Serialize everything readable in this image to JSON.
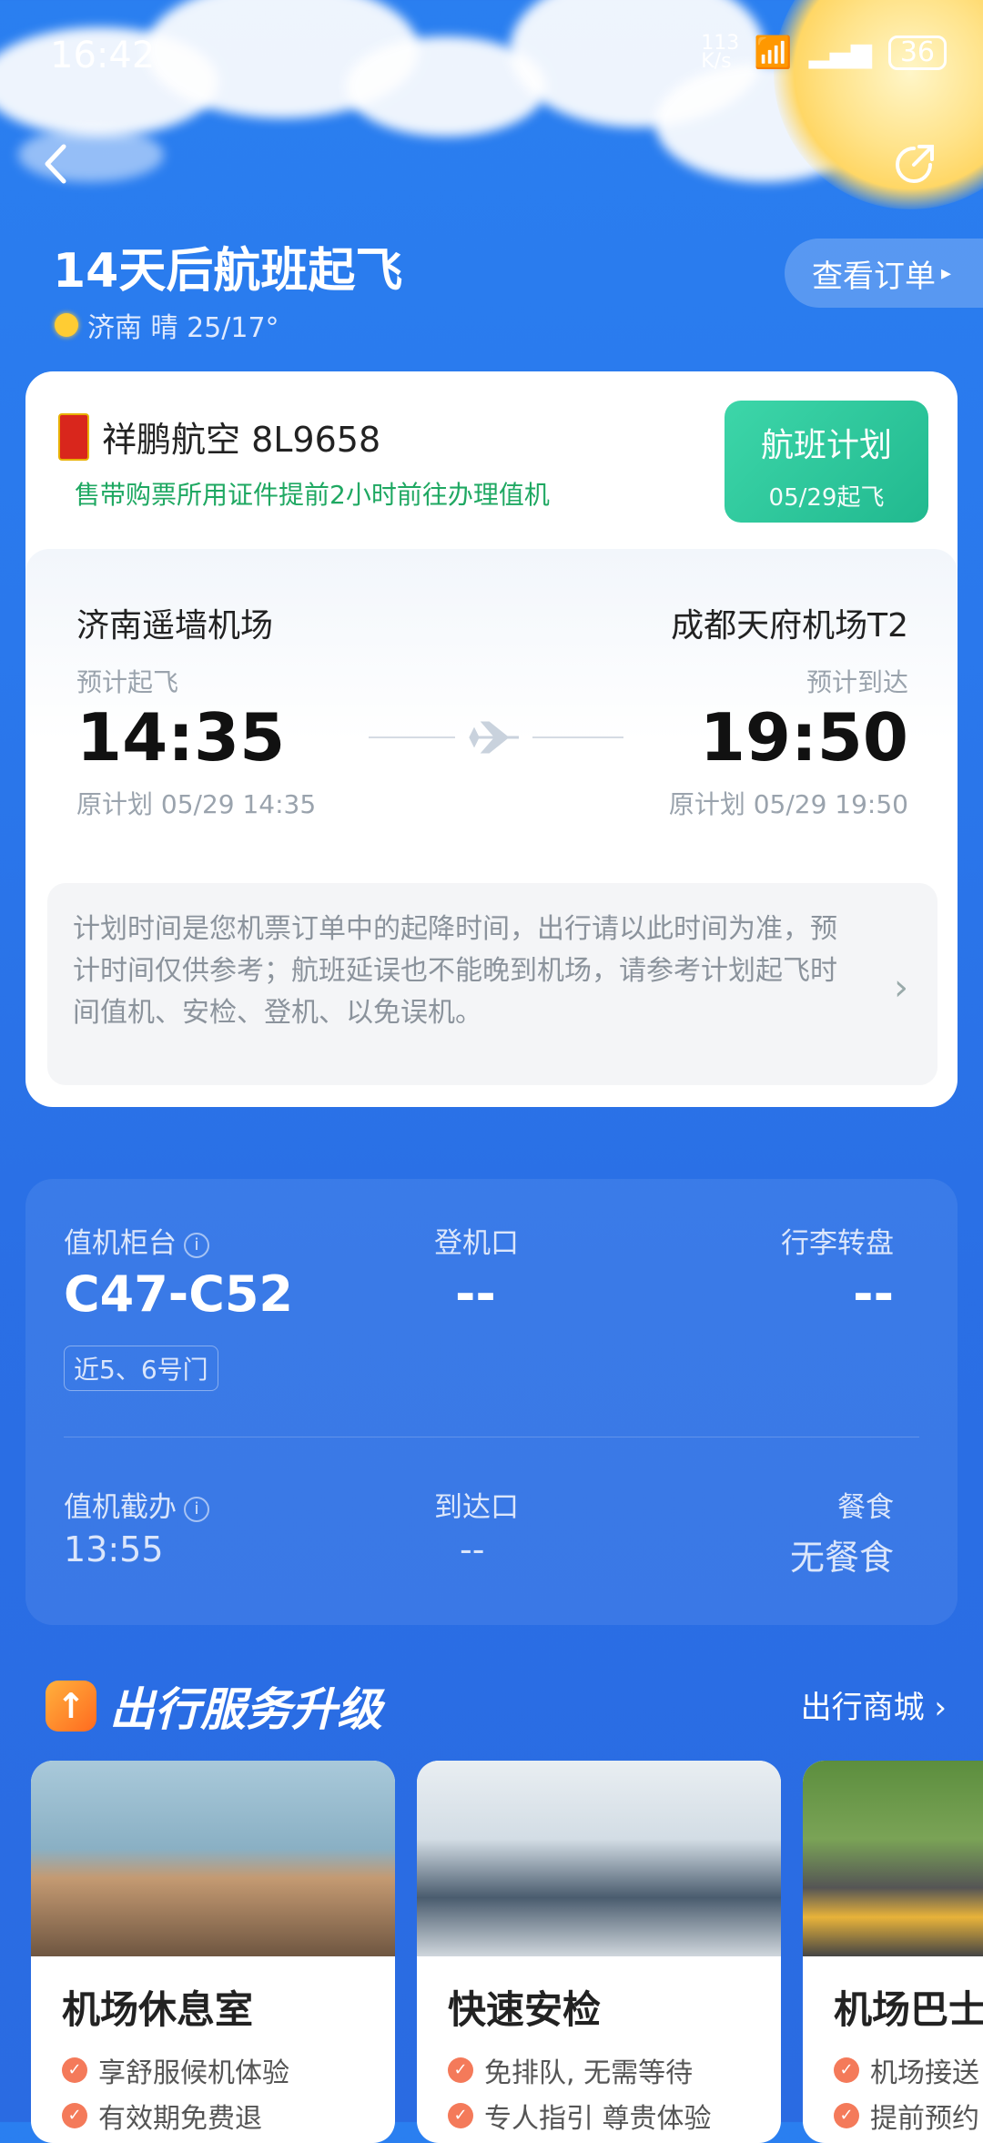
{
  "status_bar": {
    "time": "16:42",
    "net_speed": "113 K/s",
    "battery": "36"
  },
  "header": {
    "title": "14天后航班起飞",
    "weather": "济南 晴 25/17°",
    "order_button": "查看订单"
  },
  "flight": {
    "airline": "祥鹏航空 8L9658",
    "notice_green": "售带购票所用证件提前2小时前往办理值机",
    "badge_title": "航班计划",
    "badge_sub": "05/29起飞",
    "dep_airport": "济南遥墙机场",
    "arr_airport": "成都天府机场T2",
    "dep_label": "预计起飞",
    "arr_label": "预计到达",
    "dep_time": "14:35",
    "arr_time": "19:50",
    "dep_orig": "原计划 05/29 14:35",
    "arr_orig": "原计划 05/29 19:50",
    "disclaimer": "计划时间是您机票订单中的起降时间，出行请以此时间为准，预计时间仅供参考；航班延误也不能晚到机场，请参考计划起飞时间值机、安检、登机、以免误机。"
  },
  "checkin": {
    "counter_label": "值机柜台",
    "counter_value": "C47-C52",
    "gate_hint": "近5、6号门",
    "boarding_label": "登机口",
    "boarding_value": "--",
    "baggage_label": "行李转盘",
    "baggage_value": "--",
    "deadline_label": "值机截办",
    "deadline_value": "13:55",
    "arrival_label": "到达口",
    "arrival_value": "--",
    "meal_label": "餐食",
    "meal_value": "无餐食"
  },
  "services": {
    "title": "出行服务升级",
    "mall_link": "出行商城",
    "items": [
      {
        "name": "机场休息室",
        "features": [
          "享舒服候机体验",
          "有效期免费退"
        ]
      },
      {
        "name": "快速安检",
        "features": [
          "免排队, 无需等待",
          "专人指引 尊贵体验"
        ]
      },
      {
        "name": "机场巴士",
        "features": [
          "机场接送",
          "提前预约"
        ]
      }
    ]
  }
}
